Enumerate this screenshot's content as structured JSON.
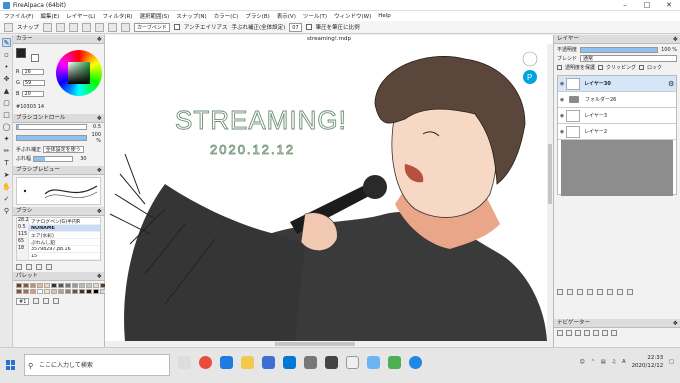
{
  "window": {
    "title": "FireAlpaca (64bit)"
  },
  "menu": [
    "ファイル(F)",
    "編集(E)",
    "レイヤー(L)",
    "フィルタ(R)",
    "選択範囲(S)",
    "スナップ(N)",
    "カラー(C)",
    "ブラシ(B)",
    "表示(V)",
    "ツール(T)",
    "ウィンドウ(W)",
    "Help"
  ],
  "toolbar": {
    "snap_label": "スナップ",
    "curve_select": "カーブペンド",
    "antialias": "アンチエイリアス",
    "correction_label": "手ぶれ補正(全体設定)",
    "correction_value": "07",
    "correction_pressure": "筆圧を筆圧に比例"
  },
  "color_panel": {
    "title": "カラー",
    "r_label": "R",
    "r_value": "16",
    "g_label": "G",
    "g_value": "59",
    "b_label": "B",
    "b_value": "20",
    "hex": "#10303 14",
    "fg_color": "#222222",
    "wheel_inner": "#2b9c4a"
  },
  "brush_control": {
    "title": "ブラシコントロール",
    "size_value": "0.5",
    "opacity_value": "100 %",
    "correction_label": "手ぶれ補正",
    "correction_select": "全体設定を使う",
    "wobble_label": "ぶれ幅",
    "wobble_value": "30"
  },
  "brush_preview": {
    "title": "ブラシプレビュー"
  },
  "brush_panel": {
    "title": "ブラシ",
    "items": [
      {
        "size": "28.2",
        "name": "アナログペン(G)半円R"
      },
      {
        "size": "0.5",
        "name": "NONAME"
      },
      {
        "size": "115",
        "name": "エア(水彩)"
      },
      {
        "size": "65",
        "name": "ぷれんし鉛"
      },
      {
        "size": "18",
        "name": "35798297.p8.16"
      },
      {
        "size": "",
        "name": "15"
      }
    ],
    "selected_index": 1
  },
  "palette_panel": {
    "title": "パレット",
    "colors": [
      "#6b3d2e",
      "#a0522d",
      "#c8906b",
      "#e8b89a",
      "#f3d4c0",
      "#333333",
      "#555555",
      "#777777",
      "#999999",
      "#bbbbbb",
      "#d4c2b0",
      "#e7d9cb",
      "#5b3a29",
      "#8f4e36",
      "#b06a4a",
      "#d99a7a",
      "#ffffff",
      "#f8e0d0",
      "#e0c0a0",
      "#c79c7a",
      "#a57a5c",
      "#70503c",
      "#4a2e20",
      "#2c1c14",
      "#000000",
      "#ecd2be"
    ],
    "page_label": "#1"
  },
  "canvas": {
    "doc_title": "streaming!.mdp",
    "heading": "STREAMING!",
    "date": "2020.12.12"
  },
  "layer_panel": {
    "title": "レイヤー",
    "opacity_label": "不透明度",
    "opacity_value": "100 %",
    "blend_label": "ブレンド",
    "blend_value": "通常",
    "protect_label": "透明度を保護",
    "clipping_label": "クリッピング",
    "lock_label": "ロック",
    "layers": [
      {
        "name": "レイヤー30",
        "type": "layer",
        "selected": true
      },
      {
        "name": "フォルダー26",
        "type": "folder",
        "selected": false
      },
      {
        "name": "レイヤー3",
        "type": "layer",
        "selected": false
      },
      {
        "name": "レイヤー2",
        "type": "layer",
        "selected": false
      }
    ]
  },
  "navigator": {
    "title": "ナビゲーター"
  },
  "taskbar": {
    "search_placeholder": "ここに入力して検索",
    "time": "22:33",
    "date": "2020/12/12"
  }
}
